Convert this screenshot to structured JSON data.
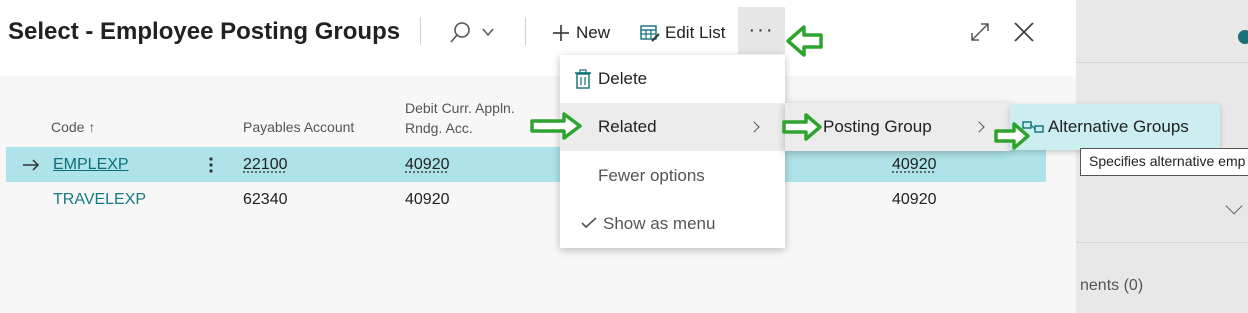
{
  "dialog": {
    "title": "Select - Employee Posting Groups",
    "toolbar": {
      "search_icon": "search-icon",
      "new_label": "New",
      "edit_list_label": "Edit List",
      "more_label": "···"
    }
  },
  "columns": {
    "code": "Code",
    "code_sort": "↑",
    "payables": "Payables Account",
    "debit_line1": "Debit Curr. Appln.",
    "debit_line2": "Rndg. Acc."
  },
  "rows": [
    {
      "code": "EMPLEXP",
      "payables": "22100",
      "debit": "40920",
      "extra": "40920",
      "selected": true
    },
    {
      "code": "TRAVELEXP",
      "payables": "62340",
      "debit": "40920",
      "extra": "40920",
      "selected": false
    }
  ],
  "more_menu": {
    "items": [
      {
        "label": "Delete",
        "icon": "trash-icon"
      },
      {
        "label": "Related",
        "icon": "chevron-right-icon",
        "highlighted": true
      },
      {
        "label": "Fewer options"
      },
      {
        "label": "Show as menu",
        "icon": "check-icon"
      }
    ]
  },
  "related_menu": {
    "items": [
      {
        "label": "Posting Group",
        "icon": "chevron-right-icon"
      }
    ]
  },
  "posting_group_menu": {
    "items": [
      {
        "label": "Alternative Groups",
        "icon": "alternative-groups-icon"
      }
    ]
  },
  "tooltip": {
    "text": "Specifies alternative emp"
  },
  "background": {
    "attachments_fragment": "nents (0)"
  },
  "colors": {
    "accent": "#167a84",
    "selected_row": "#aee4e9",
    "annotation_arrow": "#2ea42e"
  }
}
